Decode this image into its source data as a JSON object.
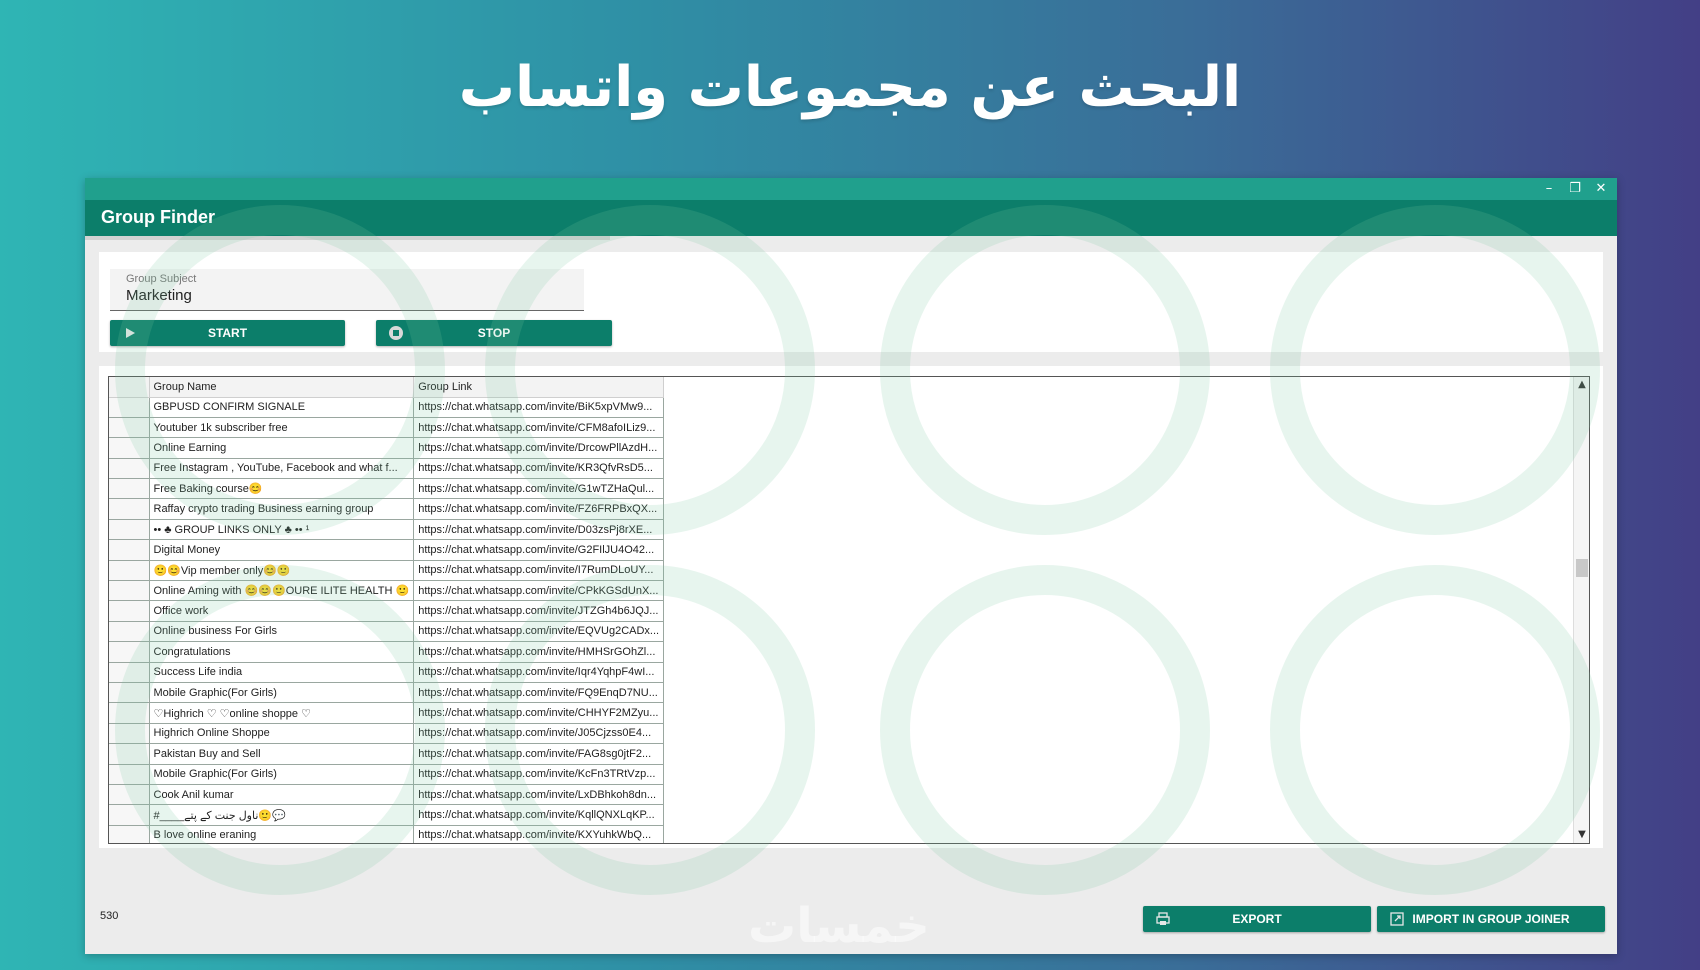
{
  "banner": {
    "title": "البحث عن مجموعات واتساب"
  },
  "window": {
    "title": "Group Finder",
    "controls": {
      "minimize": "–",
      "restore": "❐",
      "close": "✕"
    }
  },
  "search": {
    "label": "Group Subject",
    "value": "Marketing",
    "start_label": "START",
    "stop_label": "STOP"
  },
  "table": {
    "columns": [
      "",
      "Group Name",
      "Group Link"
    ],
    "rows": [
      {
        "name": "GBPUSD CONFIRM SIGNALE",
        "link": "https://chat.whatsapp.com/invite/BiK5xpVMw9..."
      },
      {
        "name": "Youtuber 1k subscriber free",
        "link": "https://chat.whatsapp.com/invite/CFM8afoILiz9..."
      },
      {
        "name": "Online Earning",
        "link": "https://chat.whatsapp.com/invite/DrcowPllAzdH..."
      },
      {
        "name": "Free Instagram , YouTube, Facebook and what f...",
        "link": "https://chat.whatsapp.com/invite/KR3QfvRsD5..."
      },
      {
        "name": "Free Baking course😊",
        "link": "https://chat.whatsapp.com/invite/G1wTZHaQul..."
      },
      {
        "name": "Raffay crypto trading Business earning group",
        "link": "https://chat.whatsapp.com/invite/FZ6FRPBxQX..."
      },
      {
        "name": "•• ♣ GROUP LINKS ONLY ♣ •• ¹",
        "link": "https://chat.whatsapp.com/invite/D03zsPj8rXE..."
      },
      {
        "name": "Digital Money",
        "link": "https://chat.whatsapp.com/invite/G2FIlJU4O42..."
      },
      {
        "name": "🙂😊Vip member only😊🙂",
        "link": "https://chat.whatsapp.com/invite/I7RumDLoUY..."
      },
      {
        "name": "Online Aming with 😊😊🙂OURE ILITE HEALTH 🙂",
        "link": "https://chat.whatsapp.com/invite/CPkKGSdUnX..."
      },
      {
        "name": "Office work",
        "link": "https://chat.whatsapp.com/invite/JTZGh4b6JQJ..."
      },
      {
        "name": "Online business For Girls",
        "link": "https://chat.whatsapp.com/invite/EQVUg2CADx..."
      },
      {
        "name": "Congratulations",
        "link": "https://chat.whatsapp.com/invite/HMHSrGOhZl..."
      },
      {
        "name": "Success Life india",
        "link": "https://chat.whatsapp.com/invite/Iqr4YqhpF4wI..."
      },
      {
        "name": "Mobile Graphic(For Girls)",
        "link": "https://chat.whatsapp.com/invite/FQ9EnqD7NU..."
      },
      {
        "name": "♡Highrich ♡ ♡online shoppe ♡",
        "link": "https://chat.whatsapp.com/invite/CHHYF2MZyu..."
      },
      {
        "name": "Highrich Online Shoppe",
        "link": "https://chat.whatsapp.com/invite/J05Cjzss0E4..."
      },
      {
        "name": "Pakistan Buy and Sell",
        "link": "https://chat.whatsapp.com/invite/FAG8sg0jtF2..."
      },
      {
        "name": "Mobile Graphic(For Girls)",
        "link": "https://chat.whatsapp.com/invite/KcFn3TRtVzp..."
      },
      {
        "name": "Cook Anil kumar",
        "link": "https://chat.whatsapp.com/invite/LxDBhkoh8dn..."
      },
      {
        "name": "#____ناول جنت کے پتے🙂💬",
        "link": "https://chat.whatsapp.com/invite/KqllQNXLqKP..."
      },
      {
        "name": "B love online eraning",
        "link": "https://chat.whatsapp.com/invite/KXYuhkWbQ..."
      }
    ]
  },
  "footer": {
    "count": "530",
    "export_label": "EXPORT",
    "import_label": "IMPORT IN GROUP JOINER"
  },
  "watermark": {
    "site": "خمسات"
  },
  "colors": {
    "accent_dark": "#0c7e6a",
    "accent_light": "#20a08d",
    "bg_start": "#2fb5b4",
    "bg_end": "#433f86"
  },
  "icons": {
    "start": "play-icon",
    "stop": "stop-circle-icon",
    "export": "printer-icon",
    "import": "external-link-icon"
  }
}
